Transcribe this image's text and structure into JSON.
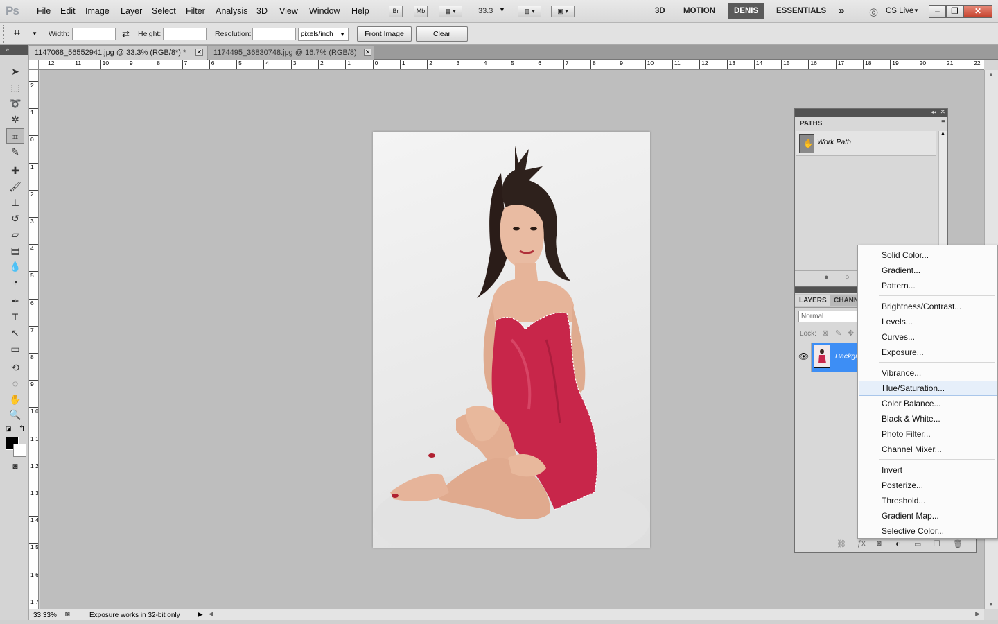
{
  "app": {
    "logo": "Ps"
  },
  "menu": [
    "File",
    "Edit",
    "Image",
    "Layer",
    "Select",
    "Filter",
    "Analysis",
    "3D",
    "View",
    "Window",
    "Help"
  ],
  "menu_extras": {
    "bridge": "Br",
    "mini_bridge": "Mb",
    "zoom": "33.3"
  },
  "workspaces": [
    "3D",
    "MOTION",
    "DENIS",
    "ESSENTIALS"
  ],
  "workspace_active": "DENIS",
  "cs_live": "CS Live",
  "options": {
    "width_label": "Width:",
    "height_label": "Height:",
    "resolution_label": "Resolution:",
    "units": "pixels/inch",
    "front_image": "Front Image",
    "clear": "Clear"
  },
  "tabs": [
    {
      "label": "1147068_56552941.jpg @ 33.3% (RGB/8*) *",
      "active": true
    },
    {
      "label": "1174495_36830748.jpg @ 16.7% (RGB/8)",
      "active": false
    }
  ],
  "ruler_h": [
    "12",
    "11",
    "10",
    "9",
    "8",
    "7",
    "6",
    "5",
    "4",
    "3",
    "2",
    "1",
    "0",
    "1",
    "2",
    "3",
    "4",
    "5",
    "6",
    "7",
    "8",
    "9",
    "10",
    "11",
    "12",
    "13",
    "14",
    "15",
    "16",
    "17",
    "18",
    "19",
    "20",
    "21",
    "22"
  ],
  "ruler_v": [
    "2",
    "1",
    "0",
    "1",
    "2",
    "3",
    "4",
    "5",
    "6",
    "7",
    "8",
    "9",
    "1 0",
    "1 1",
    "1 2",
    "1 3",
    "1 4",
    "1 5",
    "1 6",
    "1 7"
  ],
  "status": {
    "zoom": "33.33%",
    "message": "Exposure works in 32-bit only"
  },
  "paths_panel": {
    "title": "PATHS",
    "path_name": "Work Path"
  },
  "layers_panel": {
    "tabs": [
      "LAYERS",
      "CHANN"
    ],
    "blend_mode": "Normal",
    "lock_label": "Lock:",
    "layer_name": "Backgr"
  },
  "adjustment_menu": {
    "groups": [
      [
        "Solid Color...",
        "Gradient...",
        "Pattern..."
      ],
      [
        "Brightness/Contrast...",
        "Levels...",
        "Curves...",
        "Exposure..."
      ],
      [
        "Vibrance...",
        "Hue/Saturation...",
        "Color Balance...",
        "Black & White...",
        "Photo Filter...",
        "Channel Mixer..."
      ],
      [
        "Invert",
        "Posterize...",
        "Threshold...",
        "Gradient Map...",
        "Selective Color..."
      ]
    ],
    "highlighted": "Hue/Saturation..."
  },
  "colors": {
    "selection_highlight": "#3d8ef5",
    "canvas_bg": "#bebebe",
    "dress": "#c8264a"
  }
}
